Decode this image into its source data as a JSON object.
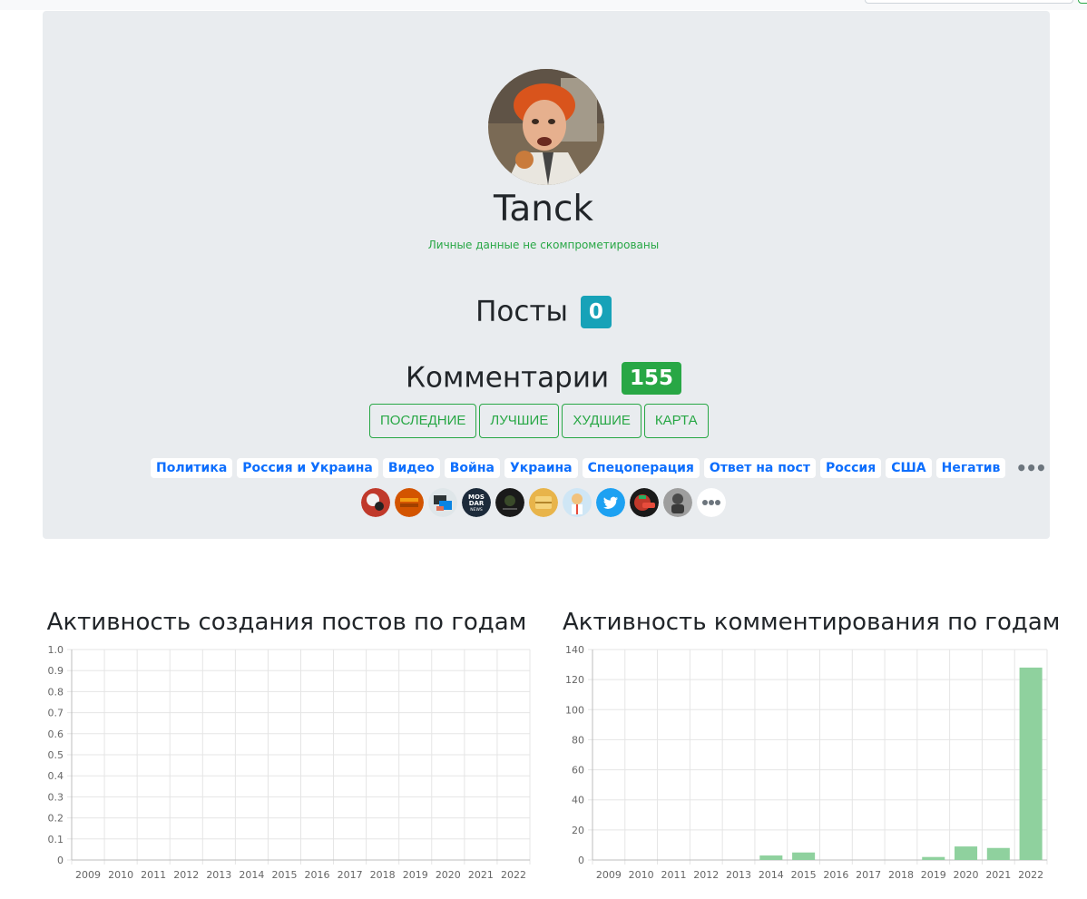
{
  "profile": {
    "username": "Tanck",
    "leak_status": "Личные данные не скомпрометированы",
    "posts_label": "Посты",
    "posts_count": "0",
    "comments_label": "Комментарии",
    "comments_count": "155"
  },
  "comment_buttons": [
    "ПОСЛЕДНИЕ",
    "ЛУЧШИЕ",
    "ХУДШИЕ",
    "КАРТА"
  ],
  "tags": [
    "Политика",
    "Россия и Украина",
    "Видео",
    "Война",
    "Украина",
    "Спецоперация",
    "Ответ на пост",
    "Россия",
    "США",
    "Негатив"
  ],
  "more_label": "•••",
  "communities": [
    {
      "icon": "community-icon-1",
      "color": "#c0392b"
    },
    {
      "icon": "community-icon-2",
      "color": "#d35400"
    },
    {
      "icon": "community-icon-3",
      "color": "#7f8c8d"
    },
    {
      "icon": "community-icon-mosdar-news",
      "color": "#1c2a3a",
      "text": "MOS DAR NEWS"
    },
    {
      "icon": "community-icon-5",
      "color": "#1a1a1a"
    },
    {
      "icon": "community-icon-6",
      "color": "#e8b44a"
    },
    {
      "icon": "community-icon-7",
      "color": "#9ec9e8"
    },
    {
      "icon": "twitter-icon",
      "color": "#1da1f2"
    },
    {
      "icon": "community-icon-9",
      "color": "#8e1111"
    },
    {
      "icon": "community-icon-10",
      "color": "#808080"
    }
  ],
  "chart_data": [
    {
      "type": "bar",
      "title": "Активность создания постов по годам",
      "categories": [
        "2009",
        "2010",
        "2011",
        "2012",
        "2013",
        "2014",
        "2015",
        "2016",
        "2017",
        "2018",
        "2019",
        "2020",
        "2021",
        "2022"
      ],
      "values": [
        0,
        0,
        0,
        0,
        0,
        0,
        0,
        0,
        0,
        0,
        0,
        0,
        0,
        0
      ],
      "ylim": [
        0,
        1.0
      ],
      "yticks": [
        "0",
        "0.1",
        "0.2",
        "0.3",
        "0.4",
        "0.5",
        "0.6",
        "0.7",
        "0.8",
        "0.9",
        "1.0"
      ],
      "grid": true,
      "color": "#8fd19e"
    },
    {
      "type": "bar",
      "title": "Активность комментирования по годам",
      "categories": [
        "2009",
        "2010",
        "2011",
        "2012",
        "2013",
        "2014",
        "2015",
        "2016",
        "2017",
        "2018",
        "2019",
        "2020",
        "2021",
        "2022"
      ],
      "values": [
        0,
        0,
        0,
        0,
        0,
        3,
        5,
        0,
        0,
        0,
        2,
        9,
        8,
        128
      ],
      "ylim": [
        0,
        140
      ],
      "yticks": [
        "0",
        "20",
        "40",
        "60",
        "80",
        "100",
        "120",
        "140"
      ],
      "grid": true,
      "color": "#8fd19e"
    }
  ]
}
